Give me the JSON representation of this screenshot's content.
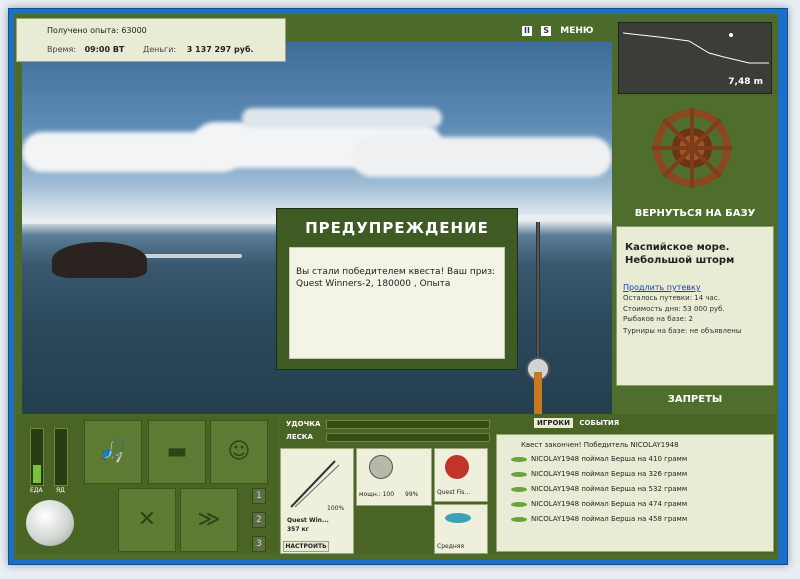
{
  "top_info": {
    "experience": "Получено опыта: 63000",
    "time_label": "Время:",
    "time_value": "09:00 ВТ",
    "money_label": "Деньги:",
    "money_value": "3 137 297 руб."
  },
  "top_buttons": {
    "pause": "II",
    "sound": "S",
    "menu": "МЕНЮ"
  },
  "minimap": {
    "depth": "7,48 m"
  },
  "right_panel": {
    "return_base": "ВЕРНУТЬСЯ НА БАЗУ",
    "location": "Каспийское море.",
    "weather": "Небольшой шторм",
    "extend_link": "Продлить путевку",
    "days_left": "Осталось путевки: 14 час.",
    "day_cost": "Стоимость дня: 53 000 руб.",
    "fishers": "Рыбаков на базе: 2",
    "tournaments": "Турниры на базе: не объявлены",
    "bans": "ЗАПРЕТЫ"
  },
  "warning": {
    "title": "ПРЕДУПРЕЖДЕНИЕ",
    "message": "Вы стали победителем квеста! Ваш приз: Quest Winners-2, 180000 , Опыта"
  },
  "meters": {
    "food": "ЕДА",
    "poison": "ЯД"
  },
  "pager": {
    "p1": "1",
    "p2": "2",
    "p3": "3"
  },
  "tackle": {
    "rod_label": "УДОЧКА",
    "line_label": "ЛЕСКА",
    "rod_name": "Quest Win...",
    "rod_weight": "357 кг",
    "rod_percent": "100%",
    "reel_power": "мощн.: 100",
    "reel_percent": "99%",
    "bait_name": "Quest Fis...",
    "lure_name": "Средняя",
    "setup_button": "НАСТРОИТЬ"
  },
  "feed": {
    "tab_players": "ИГРОКИ",
    "tab_events": "СОБЫТИЯ",
    "lines": [
      "Квест закончен! Победитель NICOLAY1948",
      "NICOLAY1948 поймал Берша на 410 грамм",
      "NICOLAY1948 поймал Берша на 326 грамм",
      "NICOLAY1948 поймал Берша на 532 грамм",
      "NICOLAY1948 поймал Берша на 474 грамм",
      "NICOLAY1948 поймал Берша на 458 грамм"
    ]
  },
  "colors": {
    "panel_green": "#4c6a2a",
    "box_cream": "#e9ecd4",
    "frame_blue": "#1b6fc6"
  }
}
